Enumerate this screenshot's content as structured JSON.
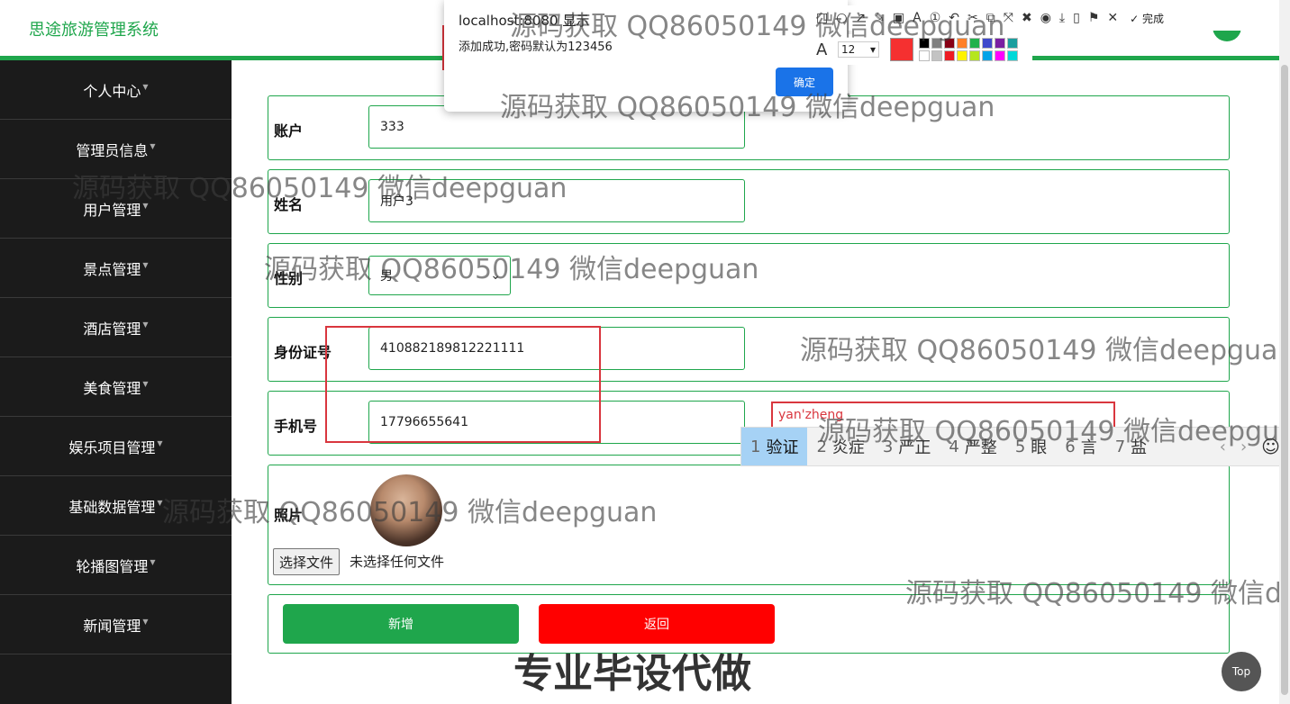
{
  "header": {
    "brand": "思途旅游管理系统"
  },
  "sidebar": {
    "items": [
      {
        "label": "个人中心"
      },
      {
        "label": "管理员信息"
      },
      {
        "label": "用户管理"
      },
      {
        "label": "景点管理"
      },
      {
        "label": "酒店管理"
      },
      {
        "label": "美食管理"
      },
      {
        "label": "娱乐项目管理"
      },
      {
        "label": "基础数据管理"
      },
      {
        "label": "轮播图管理"
      },
      {
        "label": "新闻管理"
      }
    ],
    "caret": "▼"
  },
  "form": {
    "account": {
      "label": "账户",
      "value": "333"
    },
    "name": {
      "label": "姓名",
      "value": "用户3"
    },
    "gender": {
      "label": "性别",
      "value": "男"
    },
    "idcard": {
      "label": "身份证号",
      "value": "410882189812221111"
    },
    "phone": {
      "label": "手机号",
      "value": "17796655641"
    },
    "photo": {
      "label": "照片",
      "file_button": "选择文件",
      "file_status": "未选择任何文件"
    },
    "buttons": {
      "add": "新增",
      "back": "返回"
    }
  },
  "ime": {
    "input_text": "yan'zheng",
    "candidates": [
      {
        "num": "1",
        "word": "验证"
      },
      {
        "num": "2",
        "word": "炎症"
      },
      {
        "num": "3",
        "word": "严正"
      },
      {
        "num": "4",
        "word": "严整"
      },
      {
        "num": "5",
        "word": "眼"
      },
      {
        "num": "6",
        "word": "言"
      },
      {
        "num": "7",
        "word": "盐"
      }
    ],
    "prev": "‹",
    "next": "›",
    "emoji": "☺"
  },
  "dialog": {
    "title": "localhost:8080 显示",
    "message": "添加成功,密码默认为123456",
    "ok": "确定"
  },
  "snip": {
    "tools": [
      "□",
      "○",
      "↗",
      "✎",
      "▣",
      "A",
      "①",
      "↶",
      "✂",
      "⧉",
      "⤧",
      "✖",
      "◉",
      "⤓",
      "▯",
      "⚑",
      "✕"
    ],
    "done_icon": "✓",
    "done": "完成",
    "font_icon": "A",
    "font_size": "12",
    "palette": [
      "#000000",
      "#7f7f7f",
      "#880015",
      "#ff7f27",
      "#22b14c",
      "#3f48cc",
      "#7a1fa2",
      "#1b9e9e",
      "#ffffff",
      "#c3c3c3",
      "#ed1c24",
      "#fff200",
      "#b5e61d",
      "#00a2e8",
      "#ff00ff",
      "#00d8d8"
    ]
  },
  "watermark": "源码获取 QQ86050149 微信deepguan",
  "banner": "专业毕设代做",
  "top_button": "Top"
}
